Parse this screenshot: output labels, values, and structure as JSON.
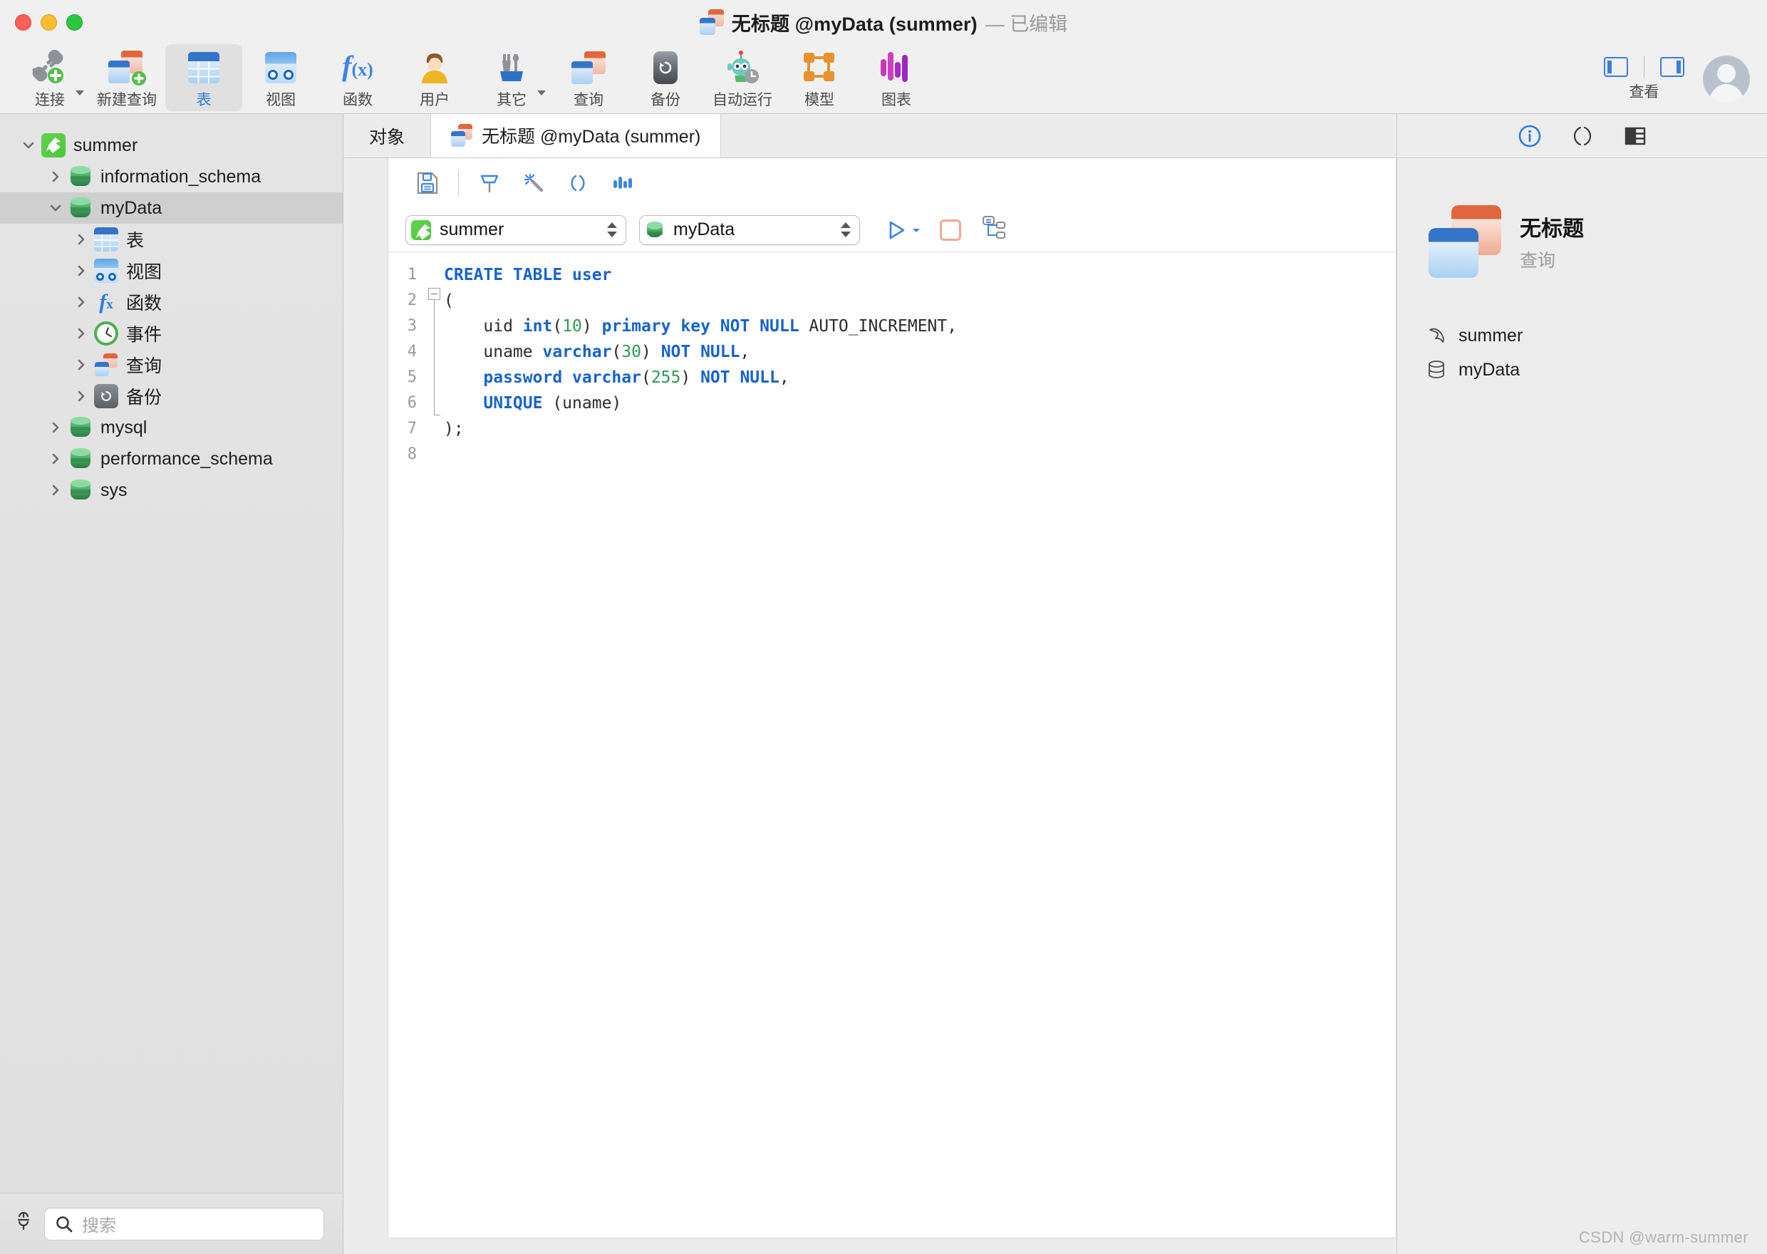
{
  "window": {
    "title": "无标题 @myData (summer)",
    "title_suffix": "— 已编辑",
    "watermark": "CSDN @warm-summer"
  },
  "toolbar": {
    "items": [
      {
        "label": "连接",
        "icon": "connection-icon",
        "has_caret": true,
        "active": false
      },
      {
        "label": "新建查询",
        "icon": "new-query-icon",
        "has_caret": false,
        "active": false
      },
      {
        "label": "表",
        "icon": "table-icon",
        "has_caret": false,
        "active": true
      },
      {
        "label": "视图",
        "icon": "view-icon",
        "has_caret": false,
        "active": false
      },
      {
        "label": "函数",
        "icon": "function-icon",
        "has_caret": false,
        "active": false
      },
      {
        "label": "用户",
        "icon": "user-icon",
        "has_caret": false,
        "active": false
      },
      {
        "label": "其它",
        "icon": "tools-icon",
        "has_caret": true,
        "active": false
      },
      {
        "label": "查询",
        "icon": "query-icon",
        "has_caret": false,
        "active": false
      },
      {
        "label": "备份",
        "icon": "backup-icon",
        "has_caret": false,
        "active": false
      },
      {
        "label": "自动运行",
        "icon": "automation-robot-icon",
        "has_caret": false,
        "active": false
      },
      {
        "label": "模型",
        "icon": "model-icon",
        "has_caret": false,
        "active": false
      },
      {
        "label": "图表",
        "icon": "chart-icon",
        "has_caret": false,
        "active": false
      }
    ],
    "view_label": "查看"
  },
  "sidebar": {
    "tree": [
      {
        "label": "summer",
        "icon": "connection-icon",
        "indent": 0,
        "twisty": "down",
        "selected": false
      },
      {
        "label": "information_schema",
        "icon": "database-icon",
        "indent": 1,
        "twisty": "right",
        "selected": false
      },
      {
        "label": "myData",
        "icon": "database-icon",
        "indent": 1,
        "twisty": "down",
        "selected": true
      },
      {
        "label": "表",
        "icon": "table-icon",
        "indent": 2,
        "twisty": "right",
        "selected": false
      },
      {
        "label": "视图",
        "icon": "view-icon",
        "indent": 2,
        "twisty": "right",
        "selected": false
      },
      {
        "label": "函数",
        "icon": "function-icon",
        "indent": 2,
        "twisty": "right",
        "selected": false
      },
      {
        "label": "事件",
        "icon": "event-clock-icon",
        "indent": 2,
        "twisty": "right",
        "selected": false
      },
      {
        "label": "查询",
        "icon": "query-icon",
        "indent": 2,
        "twisty": "right",
        "selected": false
      },
      {
        "label": "备份",
        "icon": "backup-icon",
        "indent": 2,
        "twisty": "right",
        "selected": false
      },
      {
        "label": "mysql",
        "icon": "database-icon",
        "indent": 1,
        "twisty": "right",
        "selected": false
      },
      {
        "label": "performance_schema",
        "icon": "database-icon",
        "indent": 1,
        "twisty": "right",
        "selected": false
      },
      {
        "label": "sys",
        "icon": "database-icon",
        "indent": 1,
        "twisty": "right",
        "selected": false
      }
    ],
    "search_placeholder": "搜索"
  },
  "tabs": [
    {
      "label": "对象",
      "active": false,
      "has_icon": false
    },
    {
      "label": "无标题 @myData (summer)",
      "active": true,
      "has_icon": true
    }
  ],
  "editor": {
    "toolbar_icons": [
      "save-icon",
      "beautify-format-icon",
      "magic-wand-icon",
      "parentheses-icon",
      "bar-chart-icon"
    ],
    "connection_select": {
      "value": "summer",
      "icon": "connection-icon"
    },
    "database_select": {
      "value": "myData",
      "icon": "database-icon"
    },
    "run_button": "run-icon",
    "stop_button": "stop-icon",
    "explain_button": "explain-plan-icon",
    "line_numbers": [
      "1",
      "2",
      "3",
      "4",
      "5",
      "6",
      "7",
      "8"
    ],
    "code_lines": [
      [
        {
          "t": "CREATE TABLE ",
          "c": "kw"
        },
        {
          "t": "user",
          "c": "kw"
        }
      ],
      [
        {
          "t": "(",
          "c": "plain"
        }
      ],
      [
        {
          "t": "    uid ",
          "c": "plain"
        },
        {
          "t": "int",
          "c": "kw"
        },
        {
          "t": "(",
          "c": "plain"
        },
        {
          "t": "10",
          "c": "num"
        },
        {
          "t": ") ",
          "c": "plain"
        },
        {
          "t": "primary key NOT NULL",
          "c": "kw"
        },
        {
          "t": " AUTO_INCREMENT,",
          "c": "plain"
        }
      ],
      [
        {
          "t": "    uname ",
          "c": "plain"
        },
        {
          "t": "varchar",
          "c": "kw"
        },
        {
          "t": "(",
          "c": "plain"
        },
        {
          "t": "30",
          "c": "num"
        },
        {
          "t": ") ",
          "c": "plain"
        },
        {
          "t": "NOT NULL",
          "c": "kw"
        },
        {
          "t": ",",
          "c": "plain"
        }
      ],
      [
        {
          "t": "    ",
          "c": "plain"
        },
        {
          "t": "password varchar",
          "c": "kw"
        },
        {
          "t": "(",
          "c": "plain"
        },
        {
          "t": "255",
          "c": "num"
        },
        {
          "t": ") ",
          "c": "plain"
        },
        {
          "t": "NOT NULL",
          "c": "kw"
        },
        {
          "t": ",",
          "c": "plain"
        }
      ],
      [
        {
          "t": "    ",
          "c": "plain"
        },
        {
          "t": "UNIQUE",
          "c": "kw"
        },
        {
          "t": " (uname)",
          "c": "plain"
        }
      ],
      [
        {
          "t": ");",
          "c": "plain"
        }
      ],
      [
        {
          "t": "",
          "c": "plain"
        }
      ]
    ]
  },
  "right_panel": {
    "tabs": [
      "info-icon",
      "parentheses-icon",
      "table-structure-icon"
    ],
    "title": "无标题",
    "subtitle": "查询",
    "properties": [
      {
        "label": "summer",
        "icon": "connection-icon"
      },
      {
        "label": "myData",
        "icon": "database-icon"
      }
    ]
  }
}
